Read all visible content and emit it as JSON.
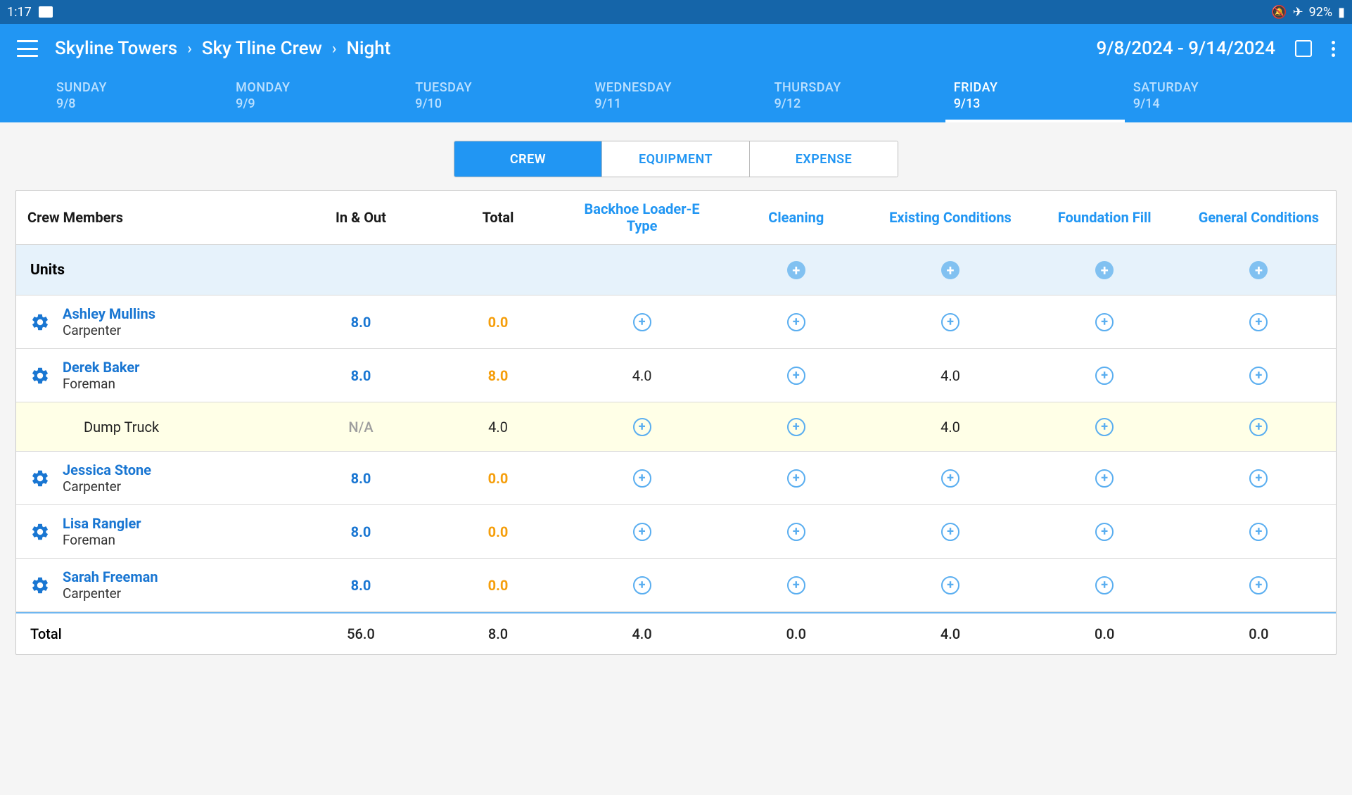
{
  "status": {
    "time": "1:17",
    "battery": "92%"
  },
  "breadcrumb": {
    "a": "Skyline Towers",
    "b": "Sky Tline Crew",
    "c": "Night"
  },
  "date_range": "9/8/2024 - 9/14/2024",
  "days": [
    {
      "name": "SUNDAY",
      "date": "9/8",
      "active": false
    },
    {
      "name": "MONDAY",
      "date": "9/9",
      "active": false
    },
    {
      "name": "TUESDAY",
      "date": "9/10",
      "active": false
    },
    {
      "name": "WEDNESDAY",
      "date": "9/11",
      "active": false
    },
    {
      "name": "THURSDAY",
      "date": "9/12",
      "active": false
    },
    {
      "name": "FRIDAY",
      "date": "9/13",
      "active": true
    },
    {
      "name": "SATURDAY",
      "date": "9/14",
      "active": false
    }
  ],
  "segments": {
    "crew": "CREW",
    "equipment": "EQUIPMENT",
    "expense": "EXPENSE",
    "active": "crew"
  },
  "columns": {
    "crew_members": "Crew Members",
    "in_out": "In & Out",
    "total": "Total",
    "c1": "Backhoe Loader-E Type",
    "c2": "Cleaning",
    "c3": "Existing Conditions",
    "c4": "Foundation Fill",
    "c5": "General Conditions"
  },
  "units_label": "Units",
  "rows": [
    {
      "type": "member",
      "name": "Ashley Mullins",
      "role": "Carpenter",
      "in_out": "8.0",
      "total": "0.0",
      "total_style": "orange",
      "c1": "add",
      "c2": "add",
      "c3": "add",
      "c4": "add",
      "c5": "add"
    },
    {
      "type": "member",
      "name": "Derek Baker",
      "role": "Foreman",
      "in_out": "8.0",
      "total": "8.0",
      "total_style": "orange",
      "c1": "4.0",
      "c2": "add",
      "c3": "4.0",
      "c4": "add",
      "c5": "add"
    },
    {
      "type": "sub",
      "name": "Dump Truck",
      "in_out": "N/A",
      "in_out_style": "gray",
      "total": "4.0",
      "total_style": "black",
      "c1": "add",
      "c2": "add",
      "c3": "4.0",
      "c4": "add",
      "c5": "add"
    },
    {
      "type": "member",
      "name": "Jessica Stone",
      "role": "Carpenter",
      "in_out": "8.0",
      "total": "0.0",
      "total_style": "orange",
      "c1": "add",
      "c2": "add",
      "c3": "add",
      "c4": "add",
      "c5": "add"
    },
    {
      "type": "member",
      "name": "Lisa Rangler",
      "role": "Foreman",
      "in_out": "8.0",
      "total": "0.0",
      "total_style": "orange",
      "c1": "add",
      "c2": "add",
      "c3": "add",
      "c4": "add",
      "c5": "add"
    },
    {
      "type": "member",
      "name": "Sarah Freeman",
      "role": "Carpenter",
      "in_out": "8.0",
      "total": "0.0",
      "total_style": "orange",
      "c1": "add",
      "c2": "add",
      "c3": "add",
      "c4": "add",
      "c5": "add"
    }
  ],
  "totals": {
    "label": "Total",
    "in_out": "56.0",
    "total": "8.0",
    "c1": "4.0",
    "c2": "0.0",
    "c3": "4.0",
    "c4": "0.0",
    "c5": "0.0"
  }
}
